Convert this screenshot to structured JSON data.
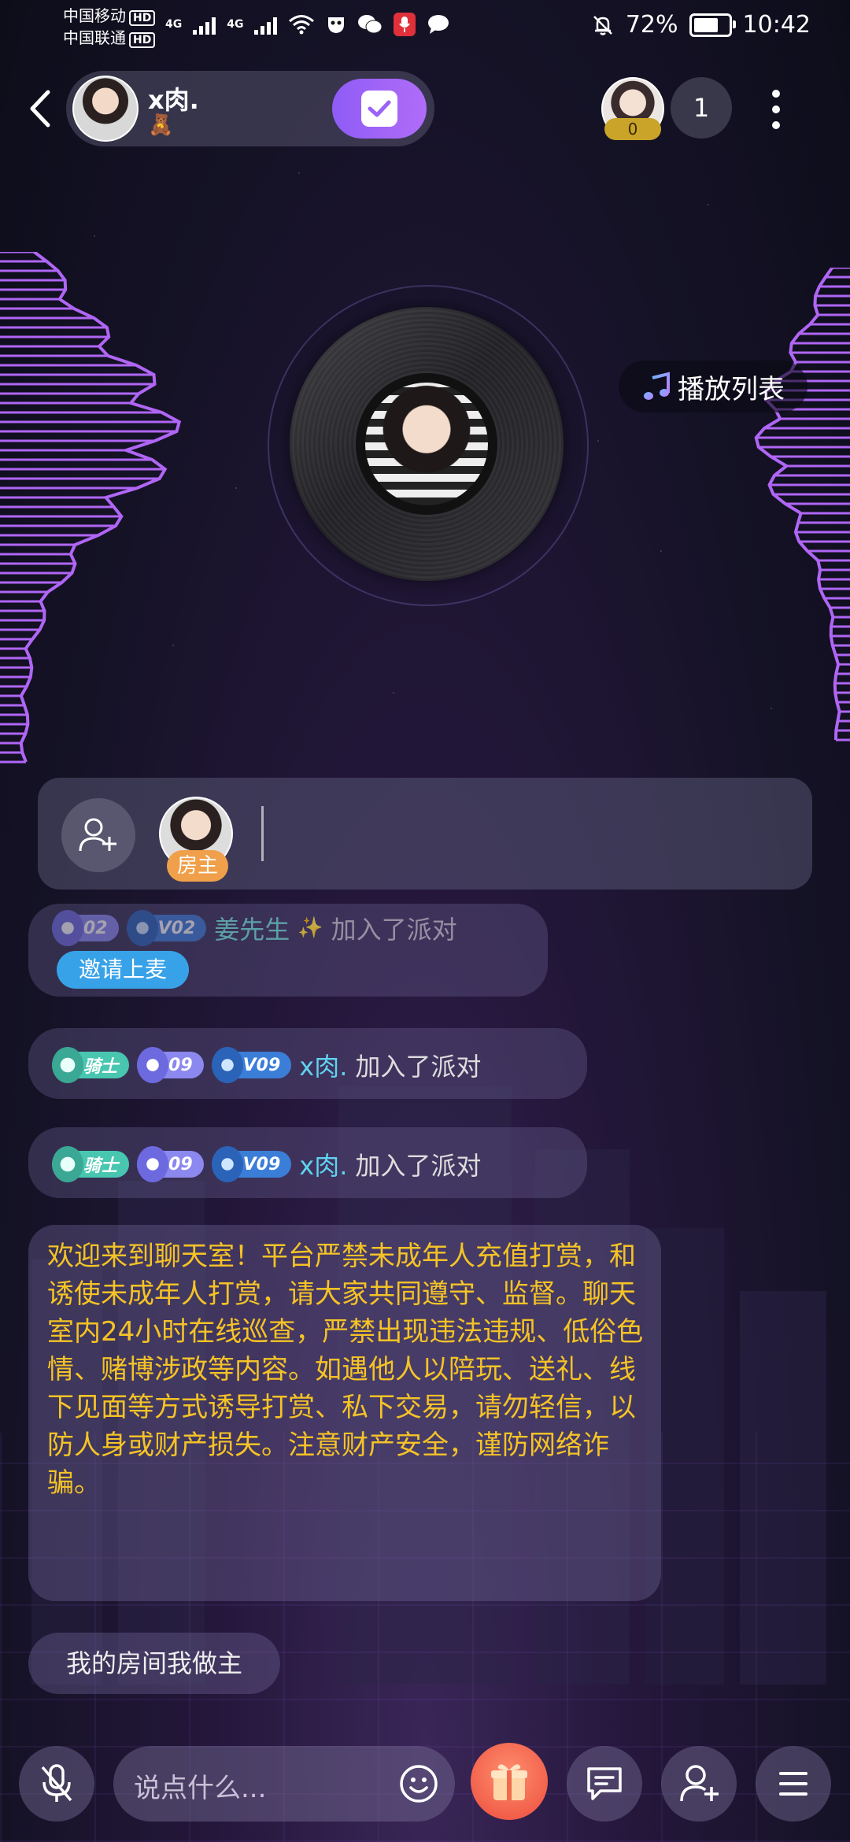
{
  "status_bar": {
    "carrier1": "中国移动",
    "carrier2": "中国联通",
    "hd": "HD",
    "net1": "4G",
    "net2": "4G",
    "battery_pct": "72%",
    "battery_level": 0.72,
    "time": "10:42"
  },
  "header": {
    "room_name": "x肉.",
    "room_sub": "🧸",
    "viewer_badge": "0",
    "viewer_count": "1"
  },
  "playlist": {
    "label": "播放列表"
  },
  "mic_bar": {
    "host_tag": "房主"
  },
  "chat": {
    "msg1": {
      "lv_badge": "02",
      "v_badge": "V02",
      "user": "姜先生",
      "sparkle": "✨",
      "action": "加入了派对",
      "invite": "邀请上麦"
    },
    "msg2": {
      "rank_badge": "骑士",
      "lv_badge": "09",
      "v_badge": "V09",
      "user": "x肉.",
      "action": "加入了派对"
    },
    "msg3": {
      "rank_badge": "骑士",
      "lv_badge": "09",
      "v_badge": "V09",
      "user": "x肉.",
      "action": "加入了派对"
    },
    "notice": "欢迎来到聊天室！平台严禁未成年人充值打赏，和诱使未成年人打赏，请大家共同遵守、监督。聊天室内24小时在线巡查，严禁出现违法违规、低俗色情、赌博涉政等内容。如遇他人以陪玩、送礼、线下见面等方式诱导打赏、私下交易，请勿轻信，以防人身或财产损失。注意财产安全，谨防网络诈骗。",
    "my_room": "我的房间我做主"
  },
  "bottom_bar": {
    "input_placeholder": "说点什么..."
  },
  "colors": {
    "accent": "#9b63f7",
    "notice_text": "#f5c326",
    "username": "#5fd3f0",
    "host_tag": "#f0a04a",
    "invite": "#38a2e8"
  }
}
